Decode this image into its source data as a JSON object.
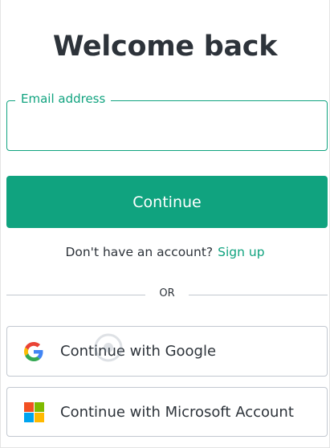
{
  "header": {
    "title": "Welcome back"
  },
  "email_field": {
    "label": "Email address",
    "value": "",
    "placeholder": ""
  },
  "continue_button": {
    "label": "Continue"
  },
  "signup": {
    "prompt": "Don't have an account?",
    "link_label": "Sign up"
  },
  "divider": {
    "text": "OR"
  },
  "social": [
    {
      "label": "Continue with Google",
      "icon": "google-logo-icon"
    },
    {
      "label": "Continue with Microsoft Account",
      "icon": "microsoft-logo-icon"
    }
  ],
  "colors": {
    "accent": "#10a37f",
    "text": "#2d333a",
    "border": "#c2c8d0"
  }
}
